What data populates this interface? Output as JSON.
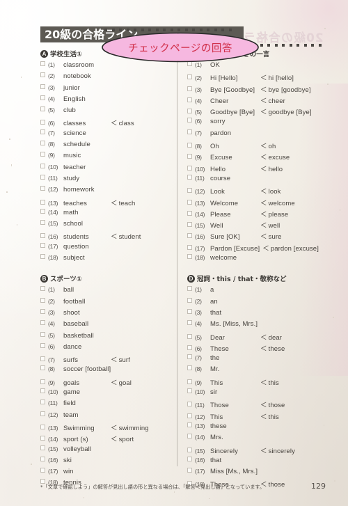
{
  "page": {
    "number": "129",
    "header_title": "20級の合格ライン",
    "ghost_text": "20級の合格ライン",
    "overlay_note": "チェックページの回答",
    "footnote": "*「文章で確認しよう」の解答が見出し語の形と異なる場合は、「解答＜見出し語」となっています。",
    "colors": {
      "paper": "#fbfaf6",
      "header_band": "#5d5a54",
      "overlay_fill": "#f6b8e0",
      "overlay_stroke": "#2a2a2a",
      "overlay_text": "#d1304b",
      "text": "#46423d",
      "checkbox_border": "#c2bdb4"
    },
    "icons": {
      "checkbox": "checkbox-icon",
      "less_than": "less-than-icon",
      "circled_letter": "circled-letter-icon",
      "dot": "dot-icon"
    }
  },
  "sections": [
    {
      "letter": "A",
      "title": "学校生活①",
      "column": "left",
      "items": [
        {
          "num": "(1)",
          "answer": "classroom",
          "alt": ""
        },
        {
          "num": "(2)",
          "answer": "notebook",
          "alt": ""
        },
        {
          "num": "(3)",
          "answer": "junior",
          "alt": ""
        },
        {
          "num": "(4)",
          "answer": "English",
          "alt": ""
        },
        {
          "num": "(5)",
          "answer": "club",
          "alt": ""
        },
        {
          "num": "(6)",
          "answer": "classes",
          "alt": "class"
        },
        {
          "num": "(7)",
          "answer": "science",
          "alt": ""
        },
        {
          "num": "(8)",
          "answer": "schedule",
          "alt": ""
        },
        {
          "num": "(9)",
          "answer": "music",
          "alt": ""
        },
        {
          "num": "(10)",
          "answer": "teacher",
          "alt": ""
        },
        {
          "num": "(11)",
          "answer": "study",
          "alt": ""
        },
        {
          "num": "(12)",
          "answer": "homework",
          "alt": ""
        },
        {
          "num": "(13)",
          "answer": "teaches",
          "alt": "teach"
        },
        {
          "num": "(14)",
          "answer": "math",
          "alt": ""
        },
        {
          "num": "(15)",
          "answer": "school",
          "alt": ""
        },
        {
          "num": "(16)",
          "answer": "students",
          "alt": "student"
        },
        {
          "num": "(17)",
          "answer": "question",
          "alt": ""
        },
        {
          "num": "(18)",
          "answer": "subject",
          "alt": ""
        }
      ]
    },
    {
      "letter": "B",
      "title": "スポーツ①",
      "column": "left",
      "items": [
        {
          "num": "(1)",
          "answer": "ball",
          "alt": ""
        },
        {
          "num": "(2)",
          "answer": "football",
          "alt": ""
        },
        {
          "num": "(3)",
          "answer": "shoot",
          "alt": ""
        },
        {
          "num": "(4)",
          "answer": "baseball",
          "alt": ""
        },
        {
          "num": "(5)",
          "answer": "basketball",
          "alt": ""
        },
        {
          "num": "(6)",
          "answer": "dance",
          "alt": ""
        },
        {
          "num": "(7)",
          "answer": "surfs",
          "alt": "surf"
        },
        {
          "num": "(8)",
          "answer": "soccer [football]",
          "alt": ""
        },
        {
          "num": "(9)",
          "answer": "goals",
          "alt": "goal"
        },
        {
          "num": "(10)",
          "answer": "game",
          "alt": ""
        },
        {
          "num": "(11)",
          "answer": "field",
          "alt": ""
        },
        {
          "num": "(12)",
          "answer": "team",
          "alt": ""
        },
        {
          "num": "(13)",
          "answer": "Swimming",
          "alt": "swimming"
        },
        {
          "num": "(14)",
          "answer": "sport (s)",
          "alt": "sport"
        },
        {
          "num": "(15)",
          "answer": "volleyball",
          "alt": ""
        },
        {
          "num": "(16)",
          "answer": "ski",
          "alt": ""
        },
        {
          "num": "(17)",
          "answer": "win",
          "alt": ""
        },
        {
          "num": "(18)",
          "answer": "tennis",
          "alt": ""
        }
      ]
    },
    {
      "letter": "C",
      "title": "あいさつ・とっさの一言",
      "column": "right",
      "items": [
        {
          "num": "(1)",
          "answer": "OK",
          "alt": ""
        },
        {
          "num": "(2)",
          "answer": "Hi [Hello]",
          "alt": "hi [hello]"
        },
        {
          "num": "(3)",
          "answer": "Bye [Goodbye]",
          "alt": "bye [goodbye]"
        },
        {
          "num": "(4)",
          "answer": "Cheer",
          "alt": "cheer"
        },
        {
          "num": "(5)",
          "answer": "Goodbye [Bye]",
          "alt": "goodbye [Bye]"
        },
        {
          "num": "(6)",
          "answer": "sorry",
          "alt": ""
        },
        {
          "num": "(7)",
          "answer": "pardon",
          "alt": ""
        },
        {
          "num": "(8)",
          "answer": "Oh",
          "alt": "oh"
        },
        {
          "num": "(9)",
          "answer": "Excuse",
          "alt": "excuse"
        },
        {
          "num": "(10)",
          "answer": "Hello",
          "alt": "hello"
        },
        {
          "num": "(11)",
          "answer": "course",
          "alt": ""
        },
        {
          "num": "(12)",
          "answer": "Look",
          "alt": "look"
        },
        {
          "num": "(13)",
          "answer": "Welcome",
          "alt": "welcome"
        },
        {
          "num": "(14)",
          "answer": "Please",
          "alt": "please"
        },
        {
          "num": "(15)",
          "answer": "Well",
          "alt": "well"
        },
        {
          "num": "(16)",
          "answer": "Sure [OK]",
          "alt": "sure"
        },
        {
          "num": "(17)",
          "answer": "Pardon [Excuse]",
          "alt": "pardon [excuse]"
        },
        {
          "num": "(18)",
          "answer": "welcome",
          "alt": ""
        }
      ]
    },
    {
      "letter": "D",
      "title": "冠詞・this / that・敬称など",
      "column": "right",
      "items": [
        {
          "num": "(1)",
          "answer": "a",
          "alt": ""
        },
        {
          "num": "(2)",
          "answer": "an",
          "alt": ""
        },
        {
          "num": "(3)",
          "answer": "that",
          "alt": ""
        },
        {
          "num": "(4)",
          "answer": "Ms. [Miss, Mrs.]",
          "alt": ""
        },
        {
          "num": "(5)",
          "answer": "Dear",
          "alt": "dear"
        },
        {
          "num": "(6)",
          "answer": "These",
          "alt": "these"
        },
        {
          "num": "(7)",
          "answer": "the",
          "alt": ""
        },
        {
          "num": "(8)",
          "answer": "Mr.",
          "alt": ""
        },
        {
          "num": "(9)",
          "answer": "This",
          "alt": "this"
        },
        {
          "num": "(10)",
          "answer": "sir",
          "alt": ""
        },
        {
          "num": "(11)",
          "answer": "Those",
          "alt": "those"
        },
        {
          "num": "(12)",
          "answer": "This",
          "alt": "this"
        },
        {
          "num": "(13)",
          "answer": "these",
          "alt": ""
        },
        {
          "num": "(14)",
          "answer": "Mrs.",
          "alt": ""
        },
        {
          "num": "(15)",
          "answer": "Sincerely",
          "alt": "sincerely"
        },
        {
          "num": "(16)",
          "answer": "that",
          "alt": ""
        },
        {
          "num": "(17)",
          "answer": "Miss [Ms., Mrs.]",
          "alt": ""
        },
        {
          "num": "(18)",
          "answer": "Those",
          "alt": "those"
        }
      ]
    }
  ]
}
